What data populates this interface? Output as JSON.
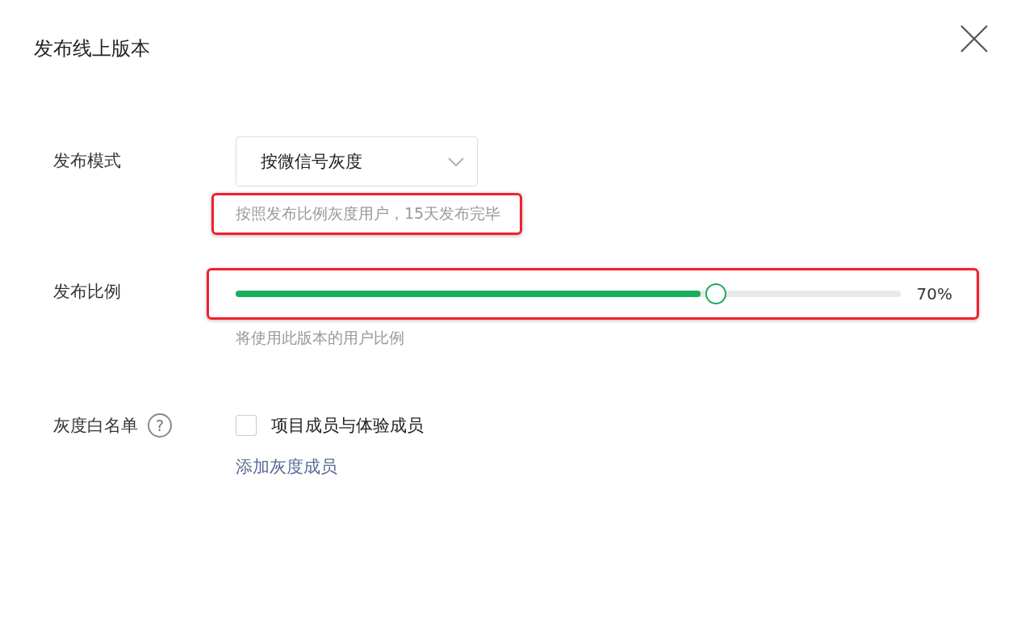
{
  "dialog": {
    "title": "发布线上版本"
  },
  "mode": {
    "label": "发布模式",
    "value": "按微信号灰度",
    "hint": "按照发布比例灰度用户，15天发布完毕",
    "highlighted": true
  },
  "ratio": {
    "label": "发布比例",
    "level": 0.7,
    "reading": "70%",
    "hint": "将使用此版本的用户比例",
    "highlighted": true
  },
  "whitelist": {
    "label": "灰度白名单",
    "help": "?",
    "option": {
      "label": "项目成员与体验成员",
      "checked": false
    },
    "link": "添加灰度成员"
  }
}
